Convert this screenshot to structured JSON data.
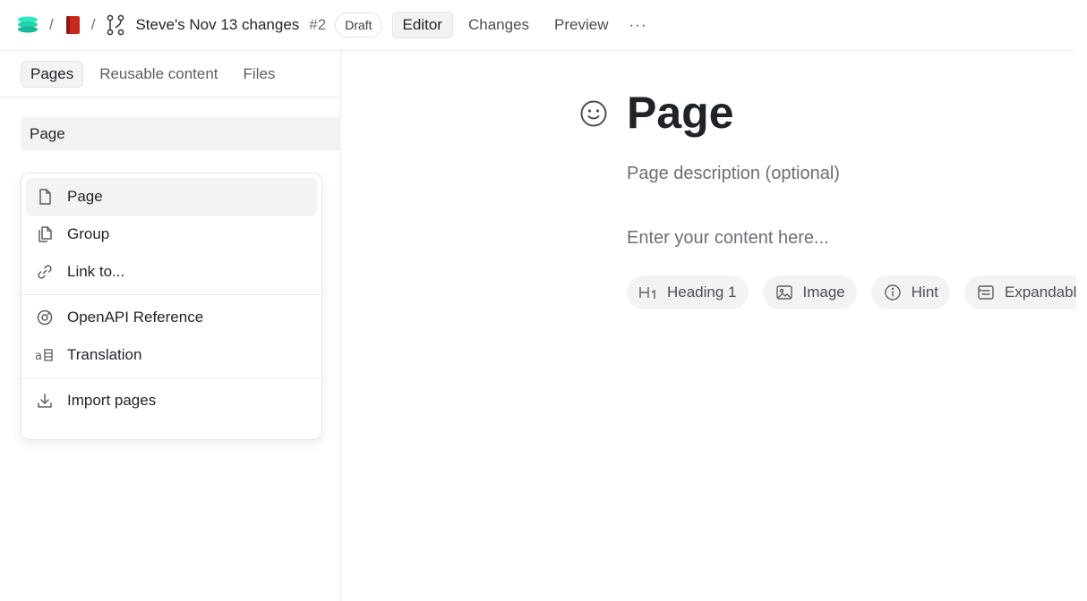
{
  "header": {
    "separator": "/",
    "branch_title": "Steve's Nov 13 changes",
    "branch_number": "#2",
    "status_badge": "Draft",
    "tabs": [
      {
        "label": "Editor",
        "active": true
      },
      {
        "label": "Changes",
        "active": false
      },
      {
        "label": "Preview",
        "active": false
      }
    ],
    "more_label": "···"
  },
  "sidebar": {
    "tabs": [
      {
        "label": "Pages",
        "active": true
      },
      {
        "label": "Reusable content",
        "active": false
      },
      {
        "label": "Files",
        "active": false
      }
    ],
    "page_row": "Page"
  },
  "menu": {
    "items": [
      {
        "label": "Page",
        "icon": "page-icon"
      },
      {
        "label": "Group",
        "icon": "group-icon"
      },
      {
        "label": "Link to...",
        "icon": "link-icon"
      },
      {
        "label": "OpenAPI Reference",
        "icon": "openapi-icon"
      },
      {
        "label": "Translation",
        "icon": "translation-icon"
      },
      {
        "label": "Import pages",
        "icon": "import-icon"
      }
    ]
  },
  "main": {
    "title": "Page",
    "description_placeholder": "Page description (optional)",
    "content_placeholder": "Enter your content here...",
    "chips": [
      {
        "label": "Heading 1",
        "icon": "heading-icon"
      },
      {
        "label": "Image",
        "icon": "image-icon"
      },
      {
        "label": "Hint",
        "icon": "hint-icon"
      },
      {
        "label": "Expandable",
        "icon": "expandable-icon"
      }
    ]
  },
  "colors": {
    "brand_teal": "#2ee6c2",
    "book_red": "#c8281e",
    "text": "#1f2328",
    "muted": "#6b6f76"
  }
}
